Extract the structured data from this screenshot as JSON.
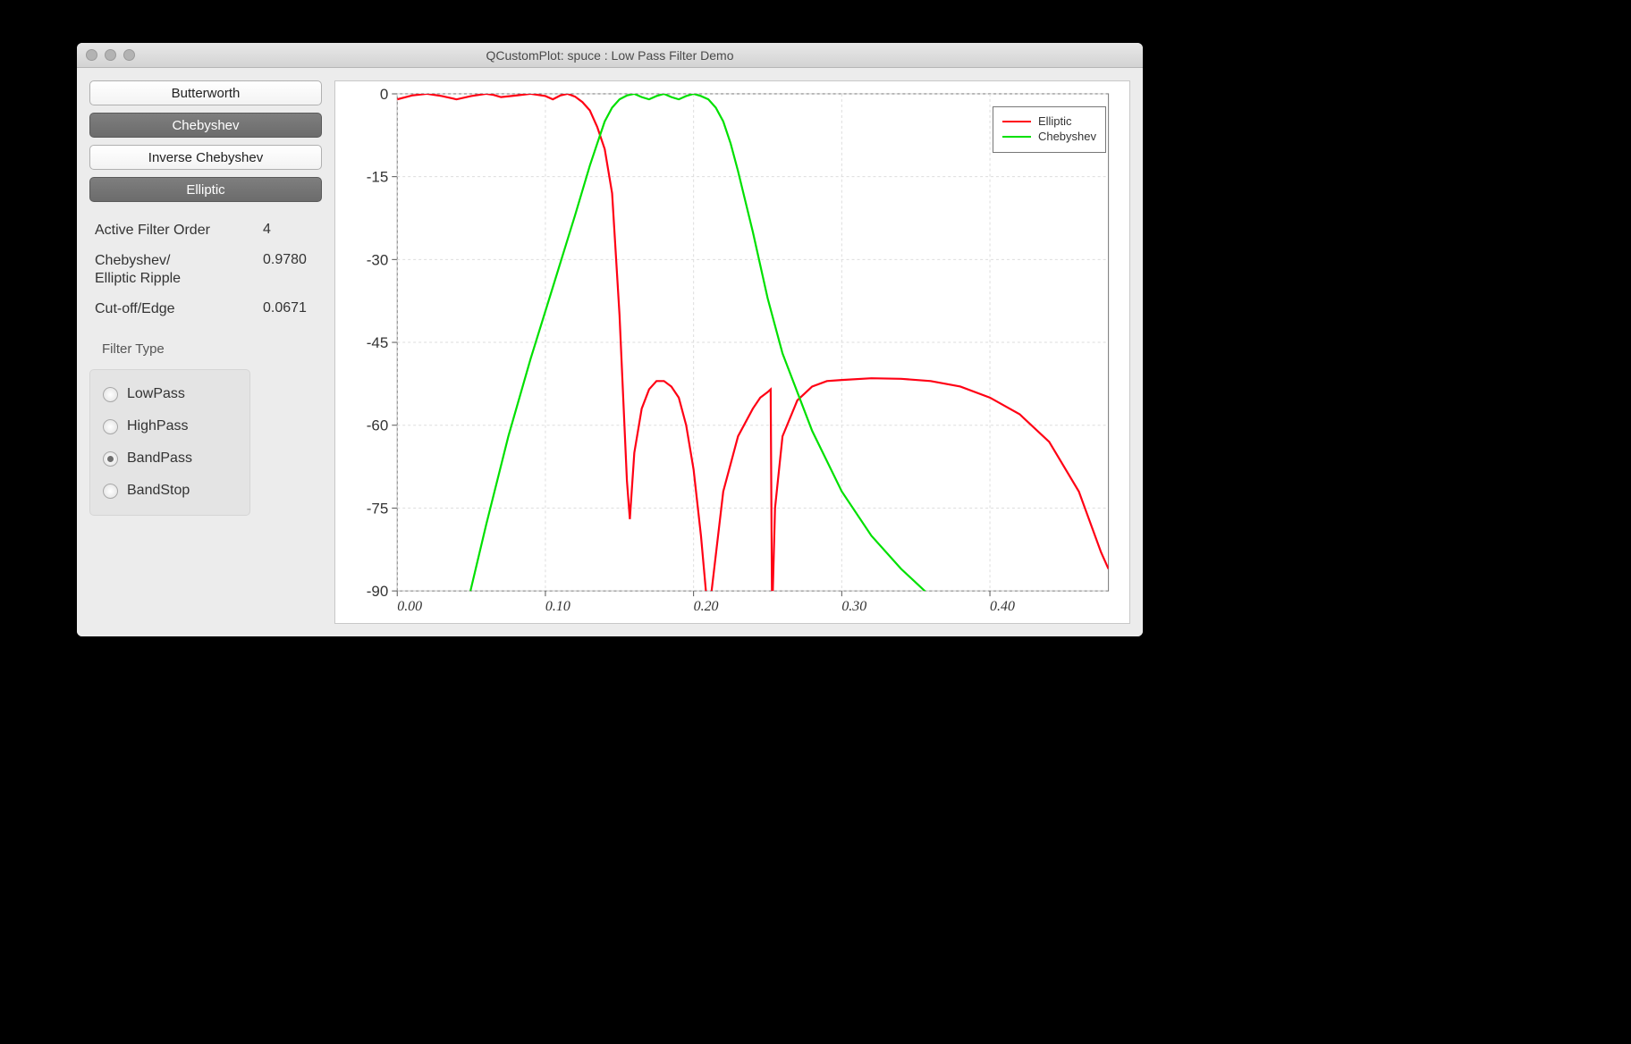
{
  "window": {
    "title": "QCustomPlot: spuce : Low Pass Filter Demo"
  },
  "buttons": {
    "butterworth": "Butterworth",
    "chebyshev": "Chebyshev",
    "inverse_chebyshev": "Inverse Chebyshev",
    "elliptic": "Elliptic"
  },
  "params": {
    "order_label": "Active Filter Order",
    "order_value": "4",
    "ripple_label": "Chebyshev/\nElliptic Ripple",
    "ripple_value": "0.9780",
    "cutoff_label": "Cut-off/Edge",
    "cutoff_value": "0.0671"
  },
  "filter_type": {
    "group_label": "Filter Type",
    "options": {
      "lowpass": "LowPass",
      "highpass": "HighPass",
      "bandpass": "BandPass",
      "bandstop": "BandStop"
    },
    "selected": "bandpass"
  },
  "legend": {
    "s0": "Elliptic",
    "s1": "Chebyshev"
  },
  "chart_data": {
    "type": "line",
    "xlabel": "",
    "ylabel": "",
    "xlim": [
      0.0,
      0.48
    ],
    "ylim": [
      -90,
      0
    ],
    "xticks": [
      0.0,
      0.1,
      0.2,
      0.3,
      0.4
    ],
    "yticks": [
      0,
      -15,
      -30,
      -45,
      -60,
      -75,
      -90
    ],
    "series": [
      {
        "name": "Elliptic",
        "color": "#ff0014",
        "x": [
          0.0,
          0.01,
          0.02,
          0.03,
          0.04,
          0.05,
          0.06,
          0.065,
          0.07,
          0.08,
          0.09,
          0.1,
          0.105,
          0.11,
          0.115,
          0.12,
          0.125,
          0.13,
          0.135,
          0.14,
          0.145,
          0.15,
          0.155,
          0.157,
          0.16,
          0.165,
          0.17,
          0.175,
          0.18,
          0.185,
          0.19,
          0.195,
          0.2,
          0.205,
          0.21,
          0.22,
          0.23,
          0.24,
          0.245,
          0.25,
          0.252,
          0.253,
          0.255,
          0.26,
          0.27,
          0.28,
          0.29,
          0.3,
          0.32,
          0.34,
          0.36,
          0.38,
          0.4,
          0.42,
          0.44,
          0.46,
          0.475,
          0.48
        ],
        "y": [
          -1,
          -0.3,
          0,
          -0.4,
          -1,
          -0.4,
          0,
          -0.2,
          -0.6,
          -0.3,
          0,
          -0.4,
          -1,
          -0.3,
          0,
          -0.5,
          -1.5,
          -3,
          -6,
          -10,
          -18,
          -40,
          -70,
          -77,
          -65,
          -57,
          -53.5,
          -52,
          -52,
          -53,
          -55,
          -60,
          -68,
          -80,
          -95,
          -72,
          -62,
          -57,
          -55,
          -54,
          -53.5,
          -95,
          -75,
          -62,
          -55.5,
          -53,
          -52,
          -51.8,
          -51.5,
          -51.6,
          -52,
          -53,
          -55,
          -58,
          -63,
          -72,
          -83,
          -86
        ]
      },
      {
        "name": "Chebyshev",
        "color": "#00e000",
        "x": [
          0.045,
          0.06,
          0.075,
          0.09,
          0.105,
          0.12,
          0.13,
          0.135,
          0.14,
          0.145,
          0.15,
          0.155,
          0.16,
          0.165,
          0.17,
          0.175,
          0.18,
          0.185,
          0.19,
          0.195,
          0.2,
          0.205,
          0.21,
          0.215,
          0.22,
          0.225,
          0.23,
          0.24,
          0.25,
          0.26,
          0.28,
          0.3,
          0.32,
          0.34,
          0.36,
          0.38,
          0.4
        ],
        "y": [
          -95,
          -78,
          -62,
          -48,
          -35,
          -22,
          -13,
          -9,
          -5,
          -2.5,
          -1,
          -0.3,
          0,
          -0.6,
          -1,
          -0.4,
          0,
          -0.6,
          -1,
          -0.4,
          0,
          -0.4,
          -1,
          -2.5,
          -5,
          -9,
          -14,
          -25,
          -37,
          -47,
          -61,
          -72,
          -80,
          -86,
          -91,
          -94,
          -96
        ]
      }
    ]
  }
}
